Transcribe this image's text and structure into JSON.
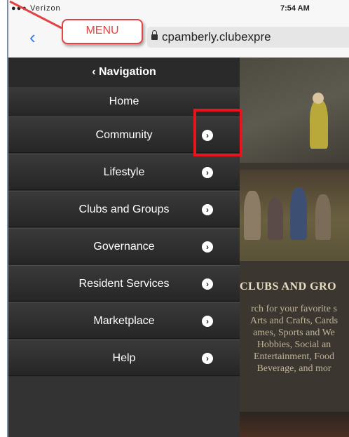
{
  "status_bar": {
    "carrier": "●●● Verizon",
    "time": "7:54 AM"
  },
  "browser": {
    "back_icon": "chevron-left-icon",
    "url": "cpamberly.clubexpre"
  },
  "callout": {
    "label": "MENU"
  },
  "nav": {
    "header": "‹ Navigation",
    "home": "Home",
    "items": [
      {
        "label": "Community"
      },
      {
        "label": "Lifestyle"
      },
      {
        "label": "Clubs and Groups"
      },
      {
        "label": "Governance"
      },
      {
        "label": "Resident Services"
      },
      {
        "label": "Marketplace"
      },
      {
        "label": "Help"
      }
    ]
  },
  "content": {
    "title": "CLUBS AND GRO",
    "lines": [
      "rch for your favorite s",
      "Arts and Crafts, Cards",
      "ames, Sports and We",
      "Hobbies, Social an",
      "Entertainment, Food",
      "Beverage, and mor"
    ]
  },
  "colors": {
    "accent": "#e8141e",
    "link": "#3478f6",
    "panel": "#2e2e2e"
  }
}
